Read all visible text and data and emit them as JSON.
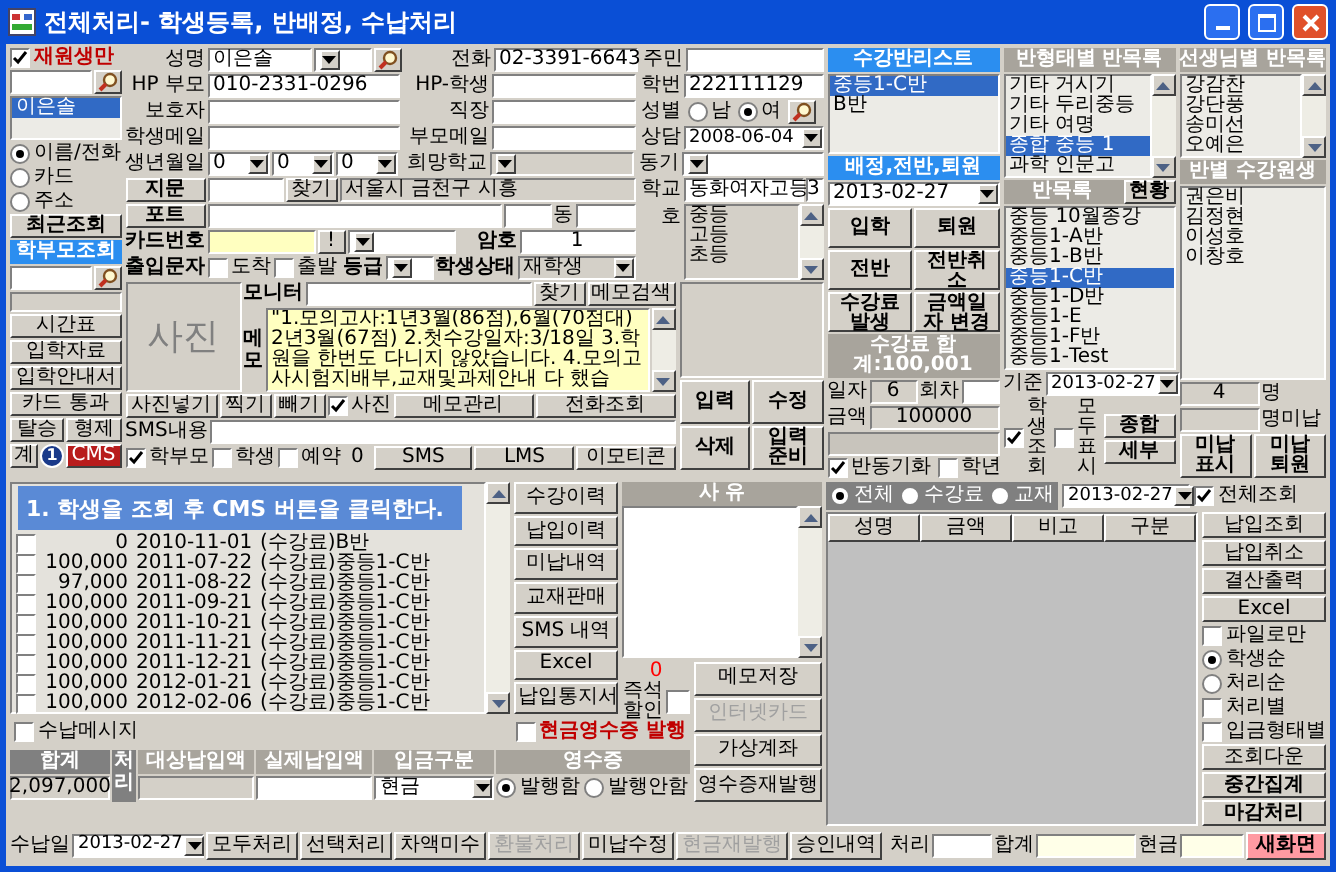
{
  "window": {
    "title": "전체처리- 학생등록, 반배정, 수납처리"
  },
  "sidebar": {
    "only_enrolled": {
      "label": "재원생만",
      "checked": true
    },
    "results": [
      {
        "name": "이은솔",
        "selected": true
      }
    ],
    "search_by": [
      {
        "label": "이름/전화",
        "selected": true
      },
      {
        "label": "카드",
        "selected": false
      },
      {
        "label": "주소",
        "selected": false
      }
    ],
    "tabs": [
      {
        "label": "최근조회",
        "selected": false
      },
      {
        "label": "학부모조회",
        "selected": true
      }
    ],
    "buttons": [
      "시간표",
      "입학자료",
      "입학안내서",
      "카드 통과"
    ],
    "small_buttons": [
      {
        "label": "탈승",
        "kind": "normal"
      },
      {
        "label": "형제",
        "kind": "normal"
      },
      {
        "label": "계",
        "kind": "normal"
      },
      {
        "label": "CMS",
        "kind": "alert"
      }
    ]
  },
  "tutorial": {
    "step": "1",
    "message": "1. 학생을 조회 후 CMS 버튼을 클릭한다."
  },
  "student": {
    "name_label": "성명",
    "name": "이은솔",
    "phone_label": "전화",
    "phone": "02-3391-6643",
    "resident_label": "주민",
    "parent_hp_label": "HP 부모",
    "parent_hp": "010-2331-0296",
    "student_hp_label": "HP-학생",
    "student_no_label": "학번",
    "student_no": "222111129",
    "guardian_label": "보호자",
    "work_label": "직장",
    "gender_label": "성별",
    "genders": [
      {
        "label": "남",
        "selected": false
      },
      {
        "label": "여",
        "selected": true
      }
    ],
    "student_mail_label": "학생메일",
    "parent_mail_label": "부모메일",
    "consult_label": "상담",
    "consult": "2008-06-04",
    "birth_label": "생년월일",
    "birth": [
      "0",
      "0",
      "0"
    ],
    "wish_school_label": "희망학교",
    "motive_label": "동기",
    "fingerprint_button": "지문",
    "find_button": "찾기",
    "address": "서울시 금천구 시흥",
    "school_label": "학교",
    "school": "동화여자고등",
    "grade": "3",
    "port_button": "포트",
    "dong_label": "동",
    "ho_label": "호",
    "school_levels": [
      {
        "name": "중등",
        "selected": false
      },
      {
        "name": "고등",
        "selected": false
      },
      {
        "name": "초등",
        "selected": false
      }
    ],
    "card_label": "카드번호",
    "card_button": "!",
    "password_label": "암호",
    "password": "1",
    "entry_sms_label": "출입문자",
    "entry_checks": [
      {
        "label": "도착",
        "checked": false
      },
      {
        "label": "출발",
        "checked": false
      }
    ],
    "level_label": "등급",
    "status_label": "학생상태",
    "status": "재학생"
  },
  "photo": {
    "label": "사진",
    "buttons": [
      "사진넣기",
      "찍기",
      "빼기"
    ],
    "show_check": {
      "label": "사진",
      "checked": true
    }
  },
  "memo": {
    "monitor_label": "모니터",
    "find_button": "찾기",
    "search_button": "메모검색",
    "memo_label": "메모",
    "text": "\"1.모의고사:1년3월(86점),6월(70점대) 2년3월(67점) 2.첫수강일자:3/18일 3.학원을 한번도 다니지 않았습니다. 4.모의고사시험지배부,교재및과제안내 다 했습",
    "buttons": [
      "메모관리",
      "전화조회"
    ]
  },
  "sms": {
    "label": "SMS내용",
    "targets": [
      {
        "label": "학부모",
        "checked": true
      },
      {
        "label": "학생",
        "checked": false
      },
      {
        "label": "예약",
        "checked": false
      }
    ],
    "count": "0",
    "buttons": [
      "SMS",
      "LMS",
      "이모티콘"
    ]
  },
  "record_buttons": [
    "입력",
    "수정",
    "삭제",
    "입력 준비"
  ],
  "class_list": {
    "title": "수강반리스트",
    "items": [
      {
        "name": "중등1-C반",
        "selected": true
      },
      {
        "name": "B반",
        "selected": false
      }
    ]
  },
  "by_type": {
    "title": "반형태별 반목록",
    "items": [
      {
        "name": "기타 거시기",
        "selected": false
      },
      {
        "name": "기타 두리중등",
        "selected": false
      },
      {
        "name": "기타 여명",
        "selected": false
      },
      {
        "name": "종합 중등 1",
        "selected": true
      },
      {
        "name": "과학 인문고",
        "selected": false
      }
    ]
  },
  "by_teacher": {
    "title": "선생님별 반목록",
    "items": [
      {
        "name": "강감찬",
        "selected": false
      },
      {
        "name": "강단풍",
        "selected": false
      },
      {
        "name": "송미선",
        "selected": false
      },
      {
        "name": "오예은",
        "selected": false
      }
    ]
  },
  "assign": {
    "title": "배정,전반,퇴원",
    "date": "2013-02-27",
    "buttons": [
      "입학",
      "퇴원",
      "전반",
      "전반취소",
      "수강료 발생",
      "금액일자 변경"
    ],
    "fee_total": "수강료 합계:100,001",
    "day_label": "일자",
    "day": "6",
    "round_label": "회차",
    "amount_label": "금액",
    "amount": "100000",
    "checks": [
      {
        "label": "반동기화",
        "checked": true
      },
      {
        "label": "학년",
        "checked": false
      }
    ]
  },
  "class_status": {
    "title": "반목록",
    "status_button": "현황",
    "items": [
      {
        "name": "중등 10월종강",
        "selected": false
      },
      {
        "name": "중등1-A반",
        "selected": false
      },
      {
        "name": "중등1-B반",
        "selected": false
      },
      {
        "name": "중등1-C반",
        "selected": true
      },
      {
        "name": "중등1-D반",
        "selected": false
      },
      {
        "name": "중등1-E",
        "selected": false
      },
      {
        "name": "중등1-F반",
        "selected": false
      },
      {
        "name": "중등1-Test",
        "selected": false
      }
    ],
    "base_label": "기준",
    "base_date": "2013-02-27",
    "checks": [
      {
        "label": "학생 조회",
        "checked": true
      },
      {
        "label": "모두 표시",
        "checked": false
      }
    ],
    "buttons": [
      "종합",
      "세부"
    ]
  },
  "class_students": {
    "title": "반별 수강원생",
    "items": [
      {
        "name": "권은비",
        "selected": false
      },
      {
        "name": "김정현",
        "selected": false
      },
      {
        "name": "이성호",
        "selected": false
      },
      {
        "name": "이창호",
        "selected": false
      }
    ],
    "count": "4",
    "count_unit": "명",
    "unpaid_unit": "명미납",
    "buttons": [
      "미납 표시",
      "미납 퇴원"
    ]
  },
  "payments": {
    "rows": [
      {
        "checked": false,
        "amount": "0",
        "date": "2010-11-01",
        "item": "(수강료)B반"
      },
      {
        "checked": false,
        "amount": "100,000",
        "date": "2011-07-22",
        "item": "(수강료)중등1-C반"
      },
      {
        "checked": false,
        "amount": "97,000",
        "date": "2011-08-22",
        "item": "(수강료)중등1-C반"
      },
      {
        "checked": false,
        "amount": "100,000",
        "date": "2011-09-21",
        "item": "(수강료)중등1-C반"
      },
      {
        "checked": false,
        "amount": "100,000",
        "date": "2011-10-21",
        "item": "(수강료)중등1-C반"
      },
      {
        "checked": false,
        "amount": "100,000",
        "date": "2011-11-21",
        "item": "(수강료)중등1-C반"
      },
      {
        "checked": false,
        "amount": "100,000",
        "date": "2011-12-21",
        "item": "(수강료)중등1-C반"
      },
      {
        "checked": false,
        "amount": "100,000",
        "date": "2012-01-21",
        "item": "(수강료)중등1-C반"
      },
      {
        "checked": false,
        "amount": "100,000",
        "date": "2012-02-06",
        "item": "(수강료)중등1-C반"
      }
    ]
  },
  "history_buttons": [
    "수강이력",
    "납입이력",
    "미납내역",
    "교재판매",
    "SMS 내역",
    "Excel",
    "납입통지서"
  ],
  "reason": {
    "title": "사 유",
    "count": "0",
    "discount_label": "즉석할인",
    "buttons": [
      {
        "label": "메모저장",
        "disabled": false
      },
      {
        "label": "인터넷카드",
        "disabled": true
      },
      {
        "label": "가상계좌",
        "disabled": false
      },
      {
        "label": "영수증재발행",
        "disabled": false
      }
    ]
  },
  "notice_check": {
    "label": "수납메시지",
    "checked": false
  },
  "cash_receipt_check": {
    "label": "현금영수증 발행",
    "checked": false
  },
  "totals": {
    "total_label": "합계",
    "total": "2,097,000",
    "process_label": "처리",
    "columns": [
      "대상납입액",
      "실제납입액",
      "입금구분",
      "영수증"
    ],
    "deposit_type": "현금",
    "receipt": [
      {
        "label": "발행함",
        "selected": true
      },
      {
        "label": "발행안함",
        "selected": false
      }
    ]
  },
  "actions": {
    "date_label": "수납일",
    "date": "2013-02-27",
    "buttons": [
      {
        "label": "모두처리",
        "disabled": false
      },
      {
        "label": "선택처리",
        "disabled": false
      },
      {
        "label": "차액미수",
        "disabled": false
      },
      {
        "label": "환불처리",
        "disabled": true
      },
      {
        "label": "미납수정",
        "disabled": false
      },
      {
        "label": "현금재발행",
        "disabled": true
      },
      {
        "label": "승인내역",
        "disabled": false
      }
    ]
  },
  "ledger": {
    "filters": [
      {
        "label": "전체",
        "selected": true
      },
      {
        "label": "수강료",
        "selected": false
      },
      {
        "label": "교재",
        "selected": false
      }
    ],
    "date": "2013-02-27",
    "all_check": {
      "label": "전체조회",
      "checked": true
    },
    "columns": [
      "성명",
      "금액",
      "비고",
      "구분"
    ],
    "buttons": [
      "납입조회",
      "납입취소",
      "결산출력",
      "Excel"
    ],
    "options": [
      {
        "kind": "check",
        "label": "파일로만",
        "on": false
      },
      {
        "kind": "radio",
        "label": "학생순",
        "on": true
      },
      {
        "kind": "radio",
        "label": "처리순",
        "on": false
      },
      {
        "kind": "check",
        "label": "처리별",
        "on": false
      },
      {
        "kind": "check",
        "label": "입금형태별",
        "on": false
      }
    ],
    "lower_buttons": [
      "조회다운",
      "중간집계",
      "마감처리"
    ],
    "process_label": "처리",
    "sum_label": "합계",
    "cash_label": "현금",
    "new_button": "새화면"
  }
}
